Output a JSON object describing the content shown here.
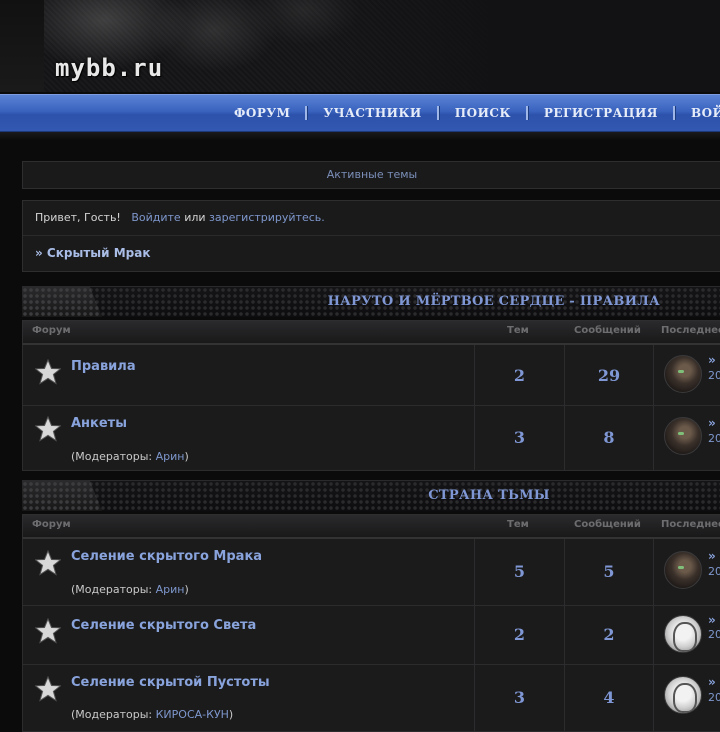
{
  "header": {
    "logo": "mybb.ru"
  },
  "nav": {
    "items": [
      "ФОРУМ",
      "УЧАСТНИКИ",
      "ПОИСК",
      "РЕГИСТРАЦИЯ",
      "ВОЙТИ"
    ]
  },
  "active_topics": "Активные темы",
  "welcome": {
    "greeting": "Привет, Гость!",
    "login": "Войдите",
    "or": "или",
    "register": "зарегистрируйтесь."
  },
  "breadcrumb": "» Скрытый Мрак",
  "table_headers": {
    "forum": "Форум",
    "topics": "Тем",
    "posts": "Сообщений",
    "last": "Последнее"
  },
  "categories": [
    {
      "title": "НАРУТО И МЁРТВОЕ СЕРДЦЕ - ПРАВИЛА",
      "forums": [
        {
          "name": "Правила",
          "moderators_prefix": "",
          "moderator": "",
          "moderators_suffix": "",
          "topics": "2",
          "posts": "29",
          "last_link": "»",
          "last_date": "20",
          "avatar": "dark"
        },
        {
          "name": "Анкеты",
          "moderators_prefix": "(Модераторы: ",
          "moderator": "Арин",
          "moderators_suffix": ")",
          "topics": "3",
          "posts": "8",
          "last_link": "»",
          "last_date": "20",
          "avatar": "dark"
        }
      ]
    },
    {
      "title": "СТРАНА ТЬМЫ",
      "forums": [
        {
          "name": "Селение скрытого Мрака",
          "moderators_prefix": "(Модераторы: ",
          "moderator": "Арин",
          "moderators_suffix": ")",
          "topics": "5",
          "posts": "5",
          "last_link": "»",
          "last_date": "20",
          "avatar": "dark"
        },
        {
          "name": "Селение скрытого Света",
          "moderators_prefix": "",
          "moderator": "",
          "moderators_suffix": "",
          "topics": "2",
          "posts": "2",
          "last_link": "»",
          "last_date": "20",
          "avatar": "light"
        },
        {
          "name": "Селение скрытой Пустоты",
          "moderators_prefix": "(Модераторы: ",
          "moderator": "КИРОСА-КУН",
          "moderators_suffix": ")",
          "topics": "3",
          "posts": "4",
          "last_link": "»",
          "last_date": "20",
          "avatar": "light"
        }
      ]
    }
  ],
  "icons": {
    "forum_status": "star-icon",
    "last_post": "avatar"
  },
  "colors": {
    "nav_blue": "#3a63bf",
    "link_blue": "#89a3dc",
    "background": "#0b0b0c"
  }
}
